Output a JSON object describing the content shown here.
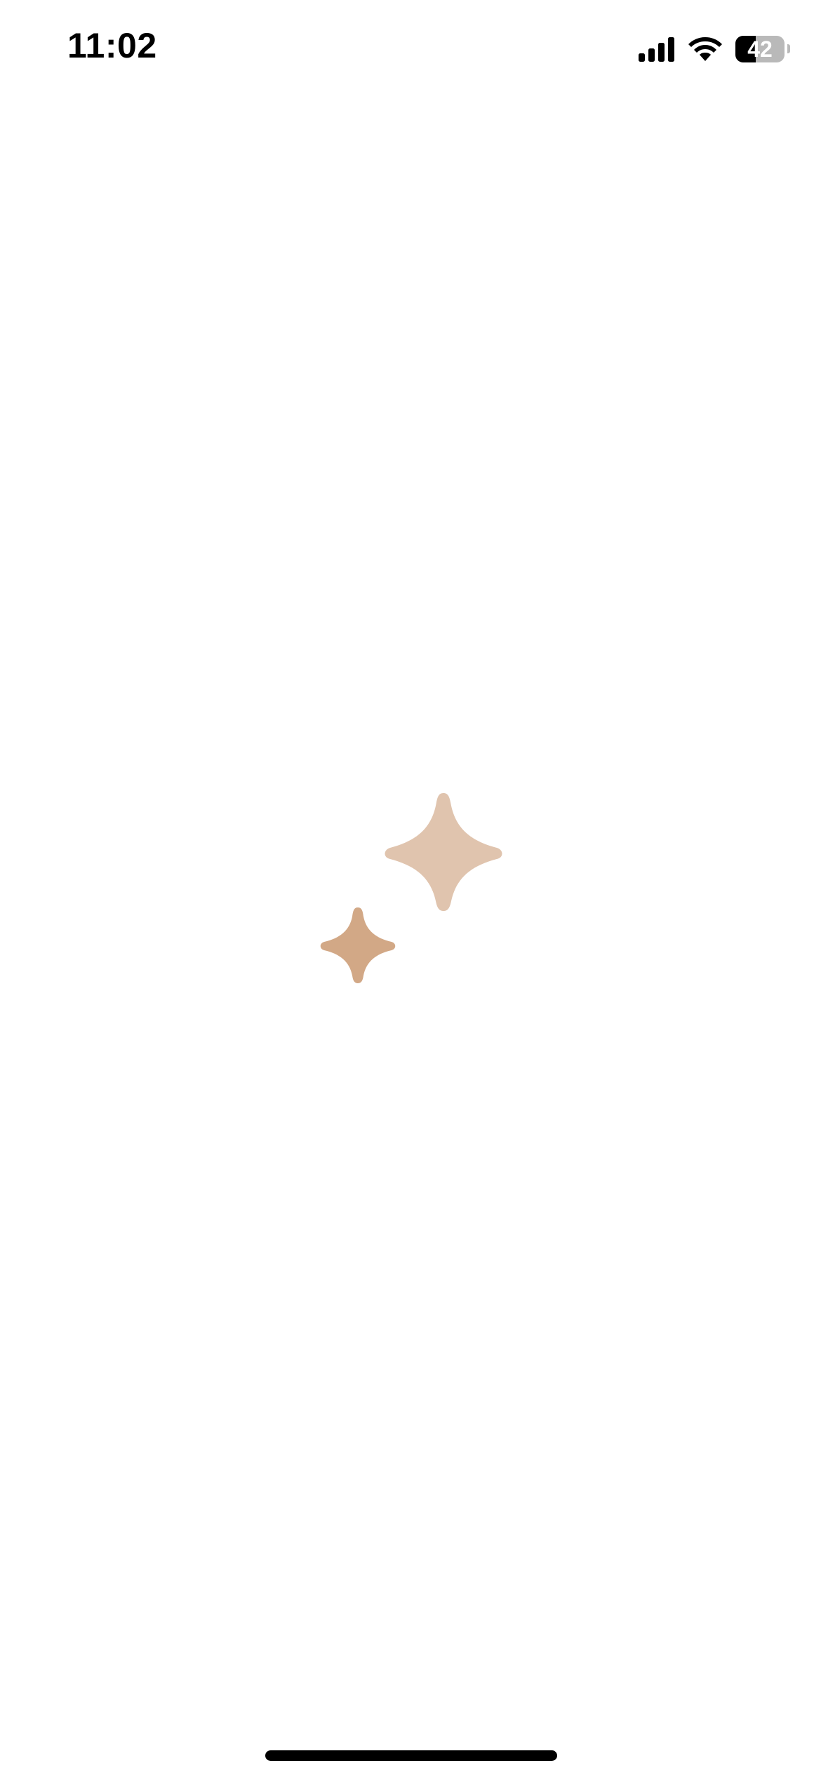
{
  "status_bar": {
    "time": "11:02",
    "battery_percent": "42",
    "battery_level": 0.42,
    "signal_icon": "cellular-signal-icon",
    "wifi_icon": "wifi-icon"
  },
  "loader": {
    "icon": "sparkles-icon",
    "large_star_color": "#e0c4ae",
    "small_star_color": "#d2a886"
  },
  "home_indicator": {
    "color": "#000000"
  }
}
